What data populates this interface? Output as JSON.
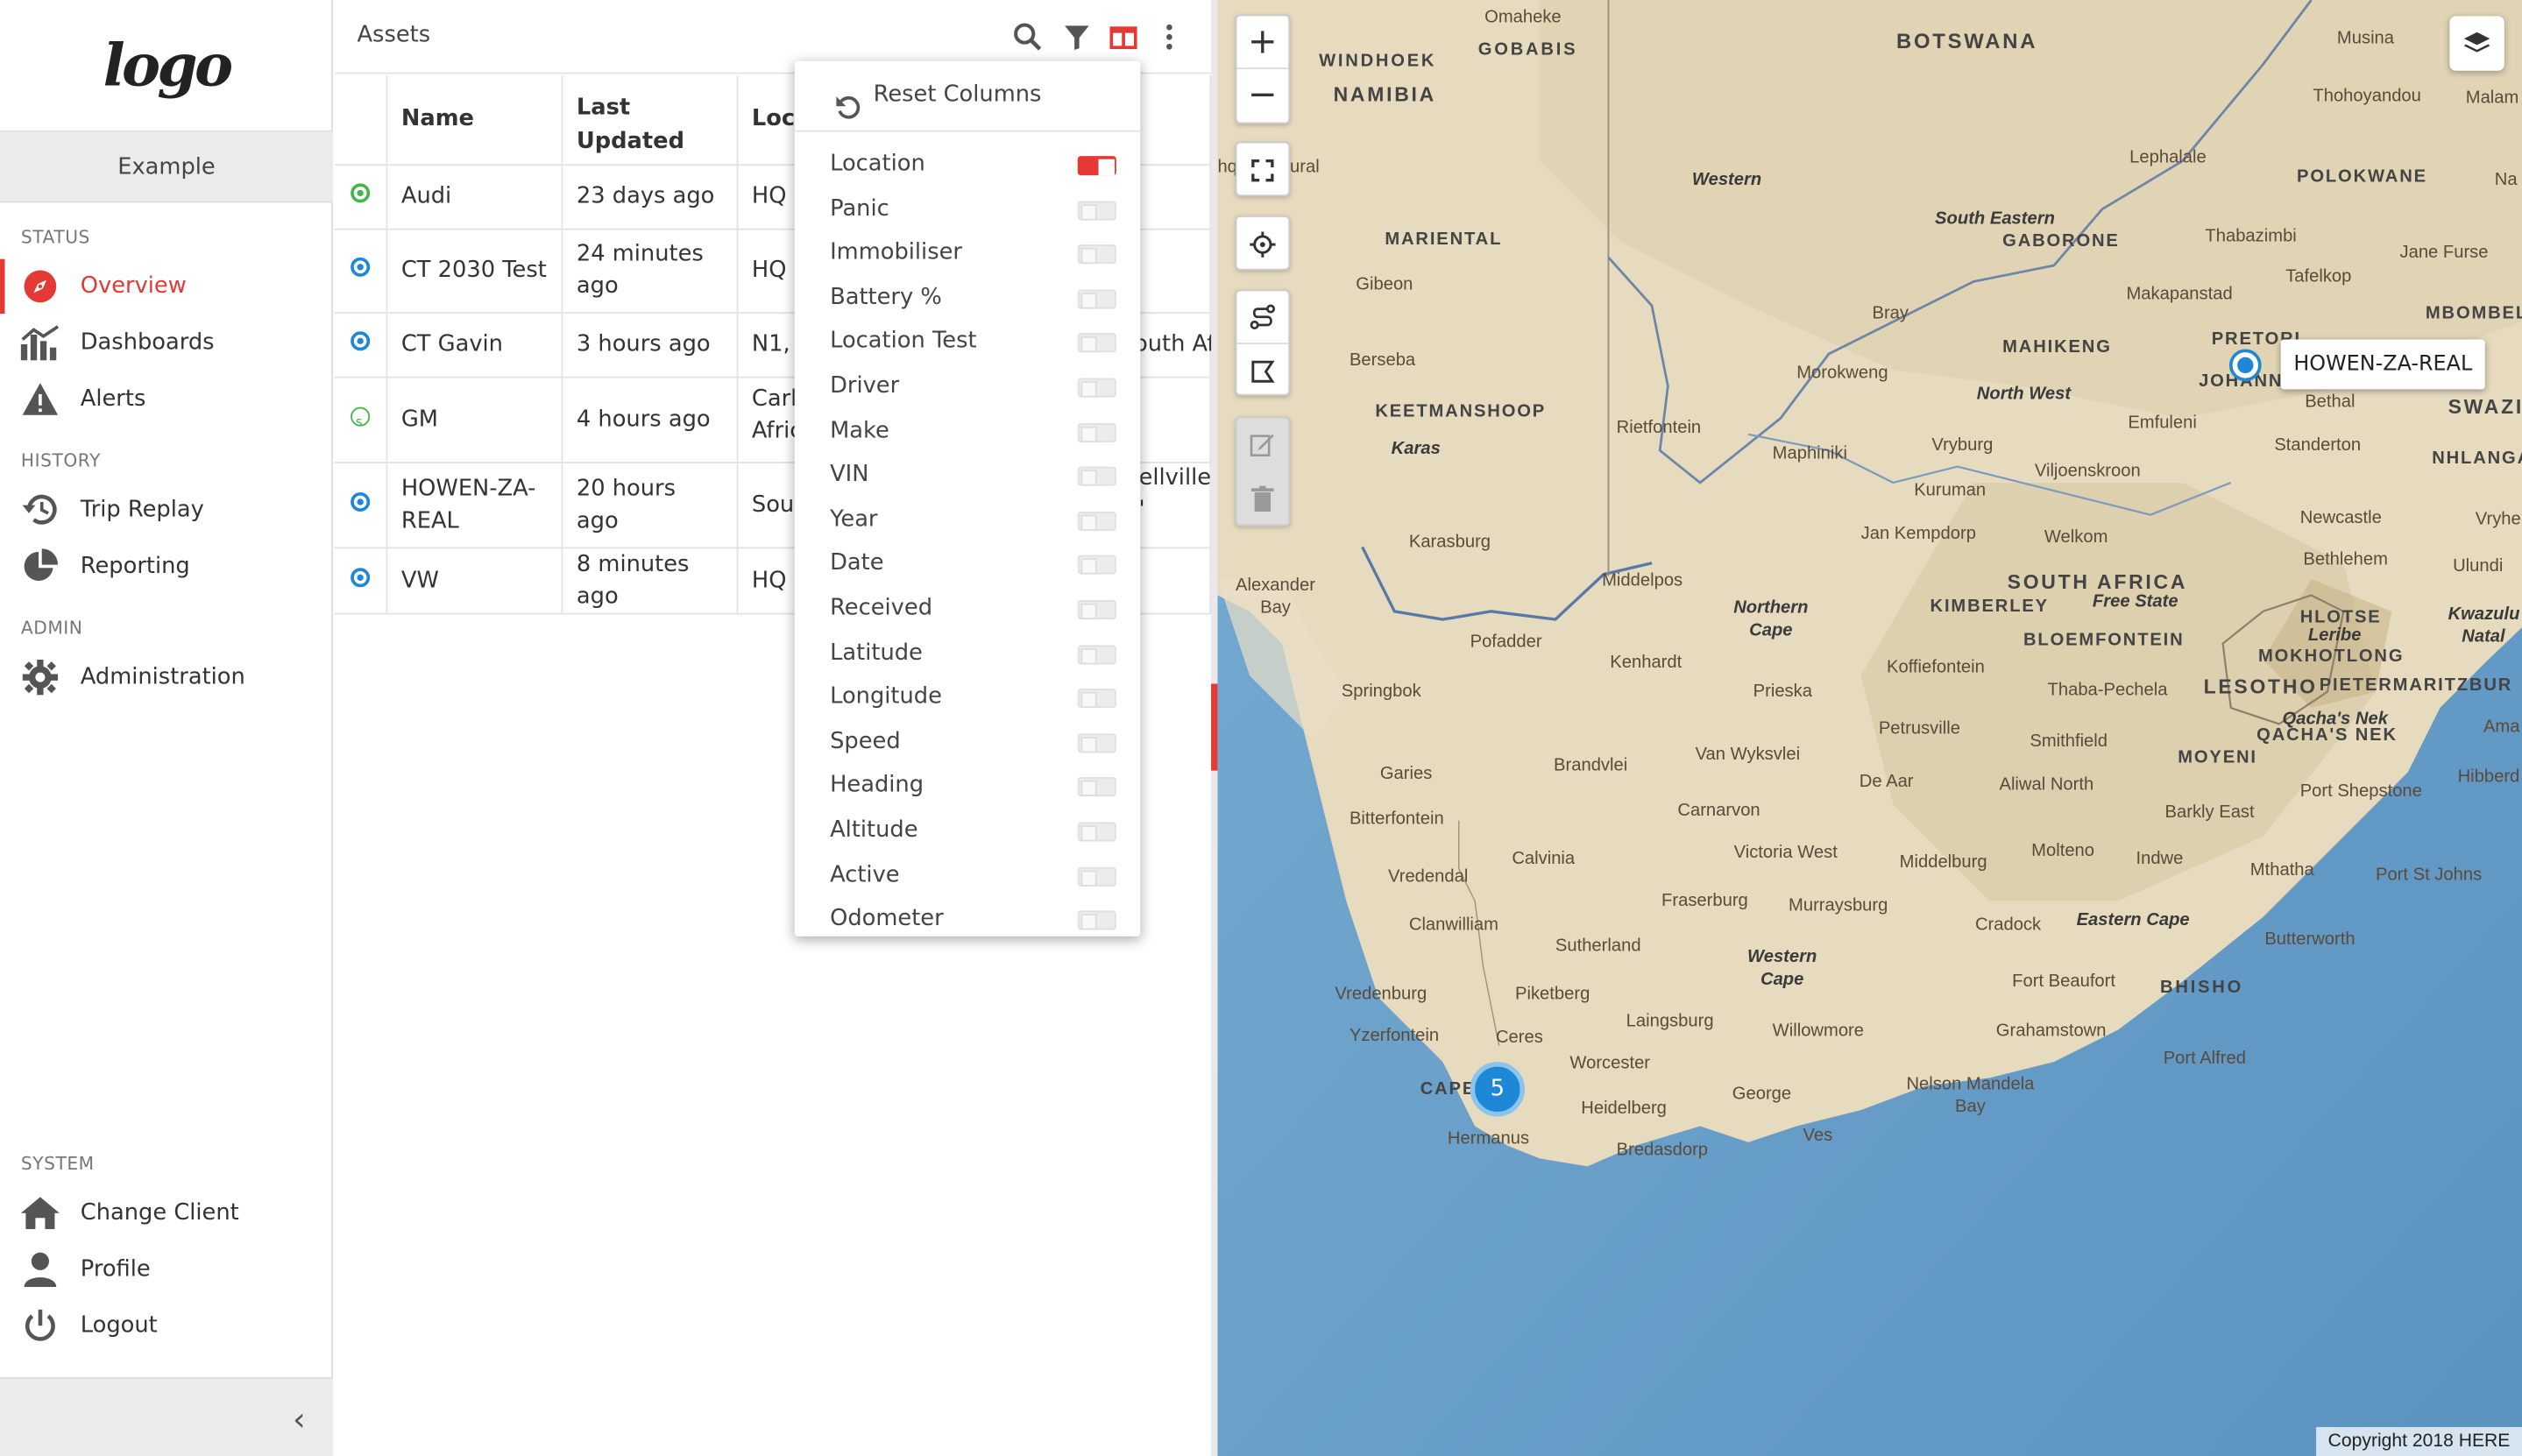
{
  "sidebar": {
    "logo_text": "logo",
    "client_name": "Example",
    "sections": {
      "status": "STATUS",
      "history": "HISTORY",
      "admin": "ADMIN",
      "system": "SYSTEM"
    },
    "items": {
      "overview": "Overview",
      "dashboards": "Dashboards",
      "alerts": "Alerts",
      "trip_replay": "Trip Replay",
      "reporting": "Reporting",
      "administration": "Administration",
      "change_client": "Change Client",
      "profile": "Profile",
      "logout": "Logout"
    },
    "collapse_icon": "chevron-left-icon"
  },
  "assets": {
    "title": "Assets",
    "toolbar_icons": [
      "search-icon",
      "filter-icon",
      "columns-icon",
      "more-vert-icon"
    ],
    "columns": {
      "name": "Name",
      "last_updated": "Last Updated",
      "location": "Loca"
    },
    "rows": [
      {
        "status": "green",
        "name": "Audi",
        "updated": "23 days ago",
        "location": "HQ",
        "extra": ""
      },
      {
        "status": "blue",
        "name": "CT 2030 Test",
        "updated": "24 minutes ago",
        "location": "HQ",
        "extra": ""
      },
      {
        "status": "blue",
        "name": "CT Gavin",
        "updated": "3 hours ago",
        "location": "N1, I",
        "extra": "outh Af"
      },
      {
        "status": "green-s",
        "name": "GM",
        "updated": "4 hours ago",
        "location": "Carl Afric",
        "extra": "ellville, '"
      },
      {
        "status": "blue",
        "name": "HOWEN-ZA-REAL",
        "updated": "20 hours ago",
        "location": "Sout",
        "extra": ""
      },
      {
        "status": "blue",
        "name": "VW",
        "updated": "8 minutes ago",
        "location": "HQ",
        "extra": ""
      }
    ]
  },
  "column_menu": {
    "reset_label": "Reset Columns",
    "options": [
      {
        "label": "Location",
        "enabled": true
      },
      {
        "label": "Panic",
        "enabled": false
      },
      {
        "label": "Immobiliser",
        "enabled": false
      },
      {
        "label": "Battery %",
        "enabled": false
      },
      {
        "label": "Location Test",
        "enabled": false
      },
      {
        "label": "Driver",
        "enabled": false
      },
      {
        "label": "Make",
        "enabled": false
      },
      {
        "label": "VIN",
        "enabled": false
      },
      {
        "label": "Year",
        "enabled": false
      },
      {
        "label": "Date",
        "enabled": false
      },
      {
        "label": "Received",
        "enabled": false
      },
      {
        "label": "Latitude",
        "enabled": false
      },
      {
        "label": "Longitude",
        "enabled": false
      },
      {
        "label": "Speed",
        "enabled": false
      },
      {
        "label": "Heading",
        "enabled": false
      },
      {
        "label": "Altitude",
        "enabled": false
      },
      {
        "label": "Active",
        "enabled": false
      },
      {
        "label": "Odometer",
        "enabled": false
      }
    ]
  },
  "map": {
    "cluster_count": "5",
    "marker_label": "HOWEN-ZA-REAL",
    "copyright": "Copyright 2018 HERE",
    "colors": {
      "accent": "#e53935",
      "marker": "#1e88d6",
      "sea": "#6fa3c9",
      "land": "#e8dcc0"
    },
    "labels": {
      "botswana": "BOTSWANA",
      "namibia": "NAMIBIA",
      "windhoek": "WINDHOEK",
      "omaheke": "Omaheke",
      "gobabis": "GOBABIS",
      "musina": "Musina",
      "thohoyandou": "Thohoyandou",
      "malam": "Malam",
      "polokwane": "POLOKWANE",
      "na": "Na",
      "lephalale": "Lephalale",
      "western": "Western",
      "south_eastern": "South Eastern",
      "gaborone": "GABORONE",
      "thabazimbi": "Thabazimbi",
      "jane_furse": "Jane Furse",
      "marienthal": "MARIENTAL",
      "gibeon": "Gibeon",
      "makapanstad": "Makapanstad",
      "tafelkop": "Tafelkop",
      "mbombela": "MBOMBEL",
      "bray": "Bray",
      "mahikeng": "MAHIKENG",
      "pretoria": "PRETORI",
      "johannesburg": "JOHANNESB",
      "berseba": "Berseba",
      "morokweng": "Morokweng",
      "north_west": "North West",
      "bethal": "Bethal",
      "swazi": "SWAZI",
      "keetmanshoop": "KEETMANSHOOP",
      "karas": "Karas",
      "rietfontein": "Rietfontein",
      "maphiniki": "Maphiniki",
      "vryburg": "Vryburg",
      "emfuleni": "Emfuleni",
      "standerton": "Standerton",
      "nhlanga": "NHLANGA",
      "viljoenskroon": "Viljoenskroon",
      "kuruman": "Kuruman",
      "newcastle": "Newcastle",
      "vryhe": "Vryhe",
      "karasburg": "Karasburg",
      "jan_kempdorp": "Jan Kempdorp",
      "welkom": "Welkom",
      "bethlehem": "Bethlehem",
      "ulundi": "Ulundi",
      "alexander_bay": "Alexander Bay",
      "middelpos": "Middelpos",
      "south_africa": "SOUTH AFRICA",
      "free_state": "Free State",
      "northern_cape": "Northern Cape",
      "kimberley": "KIMBERLEY",
      "hlotse": "HLOTSE",
      "leribe": "Leribe",
      "kwazulu": "Kwazulu Natal",
      "pofadder": "Pofadder",
      "kenhardt": "Kenhardt",
      "bloemfontein": "BLOEMFONTEIN",
      "mokhotlong": "MOKHOTLONG",
      "koffiefontein": "Koffiefontein",
      "springbok": "Springbok",
      "prieska": "Prieska",
      "thaba_pechela": "Thaba-Pechela",
      "lesotho": "LESOTHO",
      "pietermaritzburg": "PIETERMARITZBUR",
      "qachas_nek": "Qacha's Nek",
      "qachas_nek2": "QACHA'S NEK",
      "petrusville": "Petrusville",
      "smithfield": "Smithfield",
      "moyeni": "MOYENI",
      "ama": "Ama",
      "brandvlei": "Brandvlei",
      "van_wyksvlei": "Van Wyksvlei",
      "de_aar": "De Aar",
      "aliwal_north": "Aliwal North",
      "port_shepstone": "Port Shepstone",
      "hibberd": "Hibberd",
      "garies": "Garies",
      "carnarvon": "Carnarvon",
      "barkly_east": "Barkly East",
      "bitterfontein": "Bitterfontein",
      "calvinia": "Calvinia",
      "victoria_west": "Victoria West",
      "middelburg": "Middelburg",
      "molteno": "Molteno",
      "indwe": "Indwe",
      "mthatha": "Mthatha",
      "port_st_johns": "Port St Johns",
      "vredendal": "Vredendal",
      "fraserburg": "Fraserburg",
      "murraysburg": "Murraysburg",
      "cradock": "Cradock",
      "eastern_cape": "Eastern Cape",
      "clanwilliam": "Clanwilliam",
      "sutherland": "Sutherland",
      "butterworth": "Butterworth",
      "western_cape": "Western Cape",
      "vredenburg": "Vredenburg",
      "piketberg": "Piketberg",
      "fort_beaufort": "Fort Beaufort",
      "bhisho": "BHISHO",
      "yzerfontein": "Yzerfontein",
      "ceres": "Ceres",
      "laingsburg": "Laingsburg",
      "willowmore": "Willowmore",
      "grahamstown": "Grahamstown",
      "port_alfred": "Port Alfred",
      "worcester": "Worcester",
      "cape_town": "CAPE",
      "nelson_mandela_bay": "Nelson Mandela Bay",
      "heidelberg": "Heidelberg",
      "george": "George",
      "hermanus": "Hermanus",
      "bredasdorp": "Bredasdorp",
      "knysna": "Ves",
      "hq": "hq",
      "rural": "ural"
    }
  }
}
